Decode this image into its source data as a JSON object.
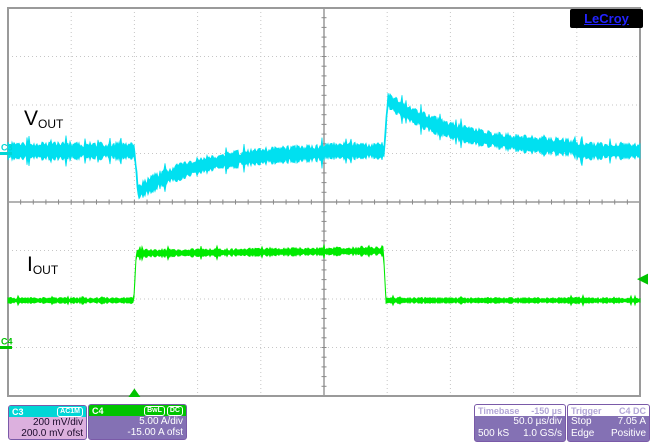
{
  "brand": {
    "logo": "LeCroy"
  },
  "annotations": {
    "vout_main": "V",
    "vout_sub": "OUT",
    "iout_main": "I",
    "iout_sub": "OUT"
  },
  "channels": {
    "c3": {
      "id": "C3",
      "coupling_badge": "AC1M",
      "scale": "200 mV/div",
      "offset": "200.0 mV ofst"
    },
    "c4": {
      "id": "C4",
      "badge_bwl": "BwL",
      "badge_dc": "DC",
      "scale": "5.00 A/div",
      "offset": "-15.00 A ofst"
    }
  },
  "timebase": {
    "title": "Timebase",
    "delay": "-150 µs",
    "per_div": "50.0 µs/div",
    "samples": "500 kS",
    "rate": "1.0 GS/s"
  },
  "trigger": {
    "title": "Trigger",
    "source": "C4 DC",
    "mode": "Stop",
    "level": "7.05 A",
    "kind": "Edge",
    "slope": "Positive"
  },
  "colors": {
    "c3_trace": "#00e0f0",
    "c3_ui": "#00d6d6",
    "c4_trace": "#00ea00",
    "c4_ui": "#00c400",
    "grid_line": "#9a9a9a",
    "grid_dot": "#c6c6c6",
    "grid_tick": "#8a8a8a"
  },
  "chart_data": {
    "type": "line",
    "x_axis": {
      "units": "µs",
      "per_div": 50,
      "divisions": 10,
      "trigger_position_div": 2
    },
    "y_axis": {
      "divisions": 8
    },
    "trigger_marker": {
      "series_index": 1,
      "level": 7.05
    },
    "series": [
      {
        "name": "VOUT (C3)",
        "units": "V",
        "per_div": 0.2,
        "offset": 0.2,
        "noise_amp": 0.026,
        "color_key": "c3_trace",
        "zero_label_key": "c3",
        "segments": [
          {
            "t0": -100,
            "t1": 0,
            "shape": "flat",
            "v": 0.01
          },
          {
            "t0": 0,
            "t1": 3,
            "shape": "ramp",
            "v0": 0.01,
            "v1": -0.16
          },
          {
            "t0": 3,
            "t1": 150,
            "shape": "exp",
            "v0": -0.16,
            "v1": 0.01,
            "tau": 48
          },
          {
            "t0": 150,
            "t1": 197.5,
            "shape": "flat",
            "v": 0.01
          },
          {
            "t0": 197.5,
            "t1": 200.5,
            "shape": "ramp",
            "v0": 0.01,
            "v1": 0.22
          },
          {
            "t0": 200.5,
            "t1": 350,
            "shape": "exp",
            "v0": 0.22,
            "v1": 0.01,
            "tau": 55
          },
          {
            "t0": 350,
            "t1": 400,
            "shape": "flat",
            "v": 0.01
          }
        ]
      },
      {
        "name": "IOUT (C4)",
        "units": "A",
        "per_div": 5,
        "offset": -15,
        "noise_amp": 0.22,
        "color_key": "c4_trace",
        "zero_label_key": "c4",
        "segments": [
          {
            "t0": -100,
            "t1": -0.5,
            "shape": "flat",
            "v": 4.85
          },
          {
            "t0": -0.5,
            "t1": 1.5,
            "shape": "ramp",
            "v0": 4.85,
            "v1": 9.7,
            "noise": 0.25
          },
          {
            "t0": 1.5,
            "t1": 197,
            "shape": "ramp",
            "v0": 9.7,
            "v1": 9.95,
            "noise": 0.3
          },
          {
            "t0": 197,
            "t1": 199,
            "shape": "ramp",
            "v0": 9.95,
            "v1": 4.85
          },
          {
            "t0": 199,
            "t1": 400,
            "shape": "flat",
            "v": 4.85
          }
        ]
      }
    ]
  }
}
